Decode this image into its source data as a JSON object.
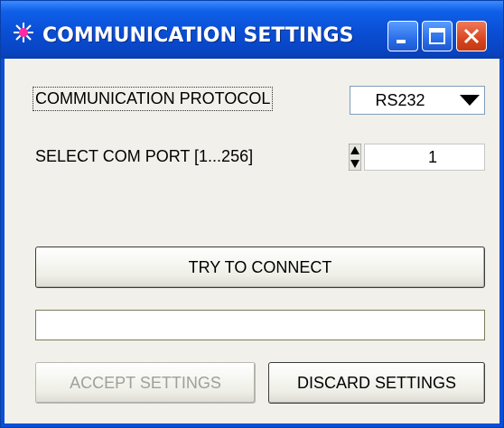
{
  "window": {
    "title": "COMMUNICATION SETTINGS",
    "title_icon": "laser-starburst-icon",
    "controls": [
      "minimize-icon",
      "maximize-icon",
      "close-icon"
    ]
  },
  "protocol": {
    "label": "COMMUNICATION PROTOCOL",
    "selected": "RS232"
  },
  "com_port": {
    "label": "SELECT COM PORT [1...256]",
    "value": "1"
  },
  "buttons": {
    "connect": "TRY TO CONNECT",
    "accept": "ACCEPT SETTINGS",
    "discard": "DISCARD SETTINGS"
  },
  "status_text": "",
  "colors": {
    "titlebar": "#0a4ed4",
    "close_button": "#d8461f",
    "client_bg": "#f1f0ea"
  }
}
